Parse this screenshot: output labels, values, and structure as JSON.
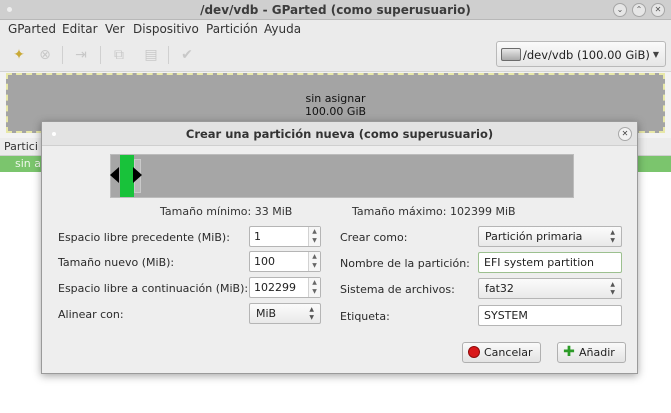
{
  "window": {
    "title": "/dev/vdb - GParted (como superusuario)"
  },
  "menu": [
    "GParted",
    "Editar",
    "Ver",
    "Dispositivo",
    "Partición",
    "Ayuda"
  ],
  "toolbar": {
    "device_selector": "/dev/vdb  (100.00 GiB)"
  },
  "disk_map": {
    "label": "sin asignar",
    "size": "100.00 GiB"
  },
  "partition_list": {
    "header_first": "Partici",
    "row_first": "sin a"
  },
  "dialog": {
    "title": "Crear una partición nueva (como superusuario)",
    "min_size": "Tamaño mínimo: 33 MiB",
    "max_size": "Tamaño máximo: 102399 MiB",
    "free_before_label": "Espacio libre precedente (MiB):",
    "free_before_value": "1",
    "new_size_label": "Tamaño nuevo (MiB):",
    "new_size_value": "100",
    "free_after_label": "Espacio libre a continuación (MiB):",
    "free_after_value": "102299",
    "align_label": "Alinear con:",
    "align_value": "MiB",
    "create_as_label": "Crear como:",
    "create_as_value": "Partición primaria",
    "part_name_label": "Nombre de la partición:",
    "part_name_value": "EFI system partition",
    "filesystem_label": "Sistema de archivos:",
    "filesystem_value": "fat32",
    "tag_label": "Etiqueta:",
    "tag_value": "SYSTEM",
    "cancel_label": "Cancelar",
    "add_label": "Añadir"
  },
  "colors": {
    "partition_bar": "#18c23a",
    "unallocated": "#a6a6a6",
    "list_row": "#7bc56d"
  }
}
